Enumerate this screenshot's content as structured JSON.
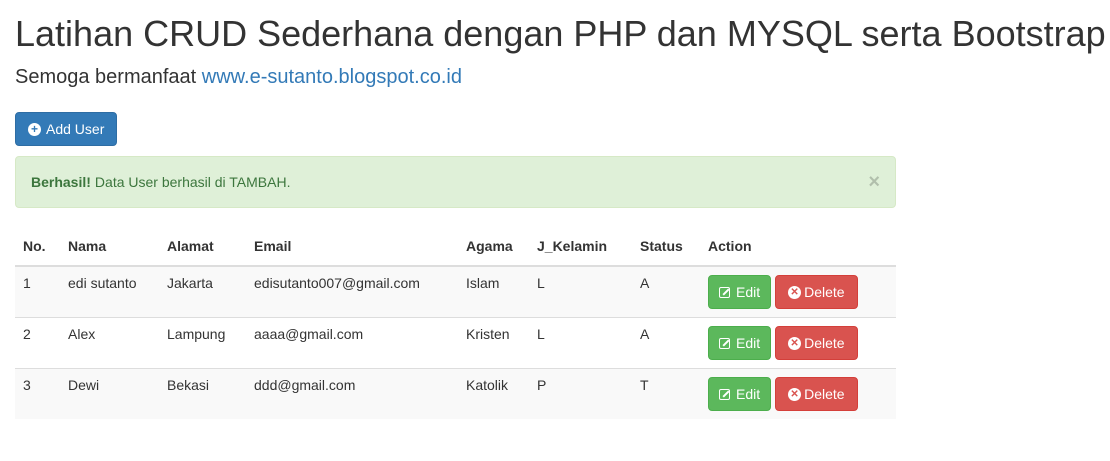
{
  "header": {
    "title": "Latihan CRUD Sederhana dengan PHP dan MYSQL serta Bootstrap",
    "subtitle_text": "Semoga bermanfaat",
    "subtitle_link": "www.e-sutanto.blogspot.co.id"
  },
  "toolbar": {
    "add_user_label": "Add User"
  },
  "alert": {
    "strong": "Berhasil!",
    "message": "Data User berhasil di TAMBAH.",
    "close": "×"
  },
  "table": {
    "headers": [
      "No.",
      "Nama",
      "Alamat",
      "Email",
      "Agama",
      "J_Kelamin",
      "Status",
      "Action"
    ],
    "rows": [
      {
        "no": "1",
        "nama": "edi sutanto",
        "alamat": "Jakarta",
        "email": "edisutanto007@gmail.com",
        "agama": "Islam",
        "jk": "L",
        "status": "A"
      },
      {
        "no": "2",
        "nama": "Alex",
        "alamat": "Lampung",
        "email": "aaaa@gmail.com",
        "agama": "Kristen",
        "jk": "L",
        "status": "A"
      },
      {
        "no": "3",
        "nama": "Dewi",
        "alamat": "Bekasi",
        "email": "ddd@gmail.com",
        "agama": "Katolik",
        "jk": "P",
        "status": "T"
      }
    ],
    "edit_label": "Edit",
    "delete_label": "Delete"
  },
  "colors": {
    "primary": "#337ab7",
    "success": "#5cb85c",
    "danger": "#d9534f",
    "alert_bg": "#dff0d8",
    "alert_text": "#3c763d"
  },
  "icons": {
    "add": "plus-circle-icon",
    "edit": "edit-icon",
    "delete": "remove-circle-icon"
  }
}
